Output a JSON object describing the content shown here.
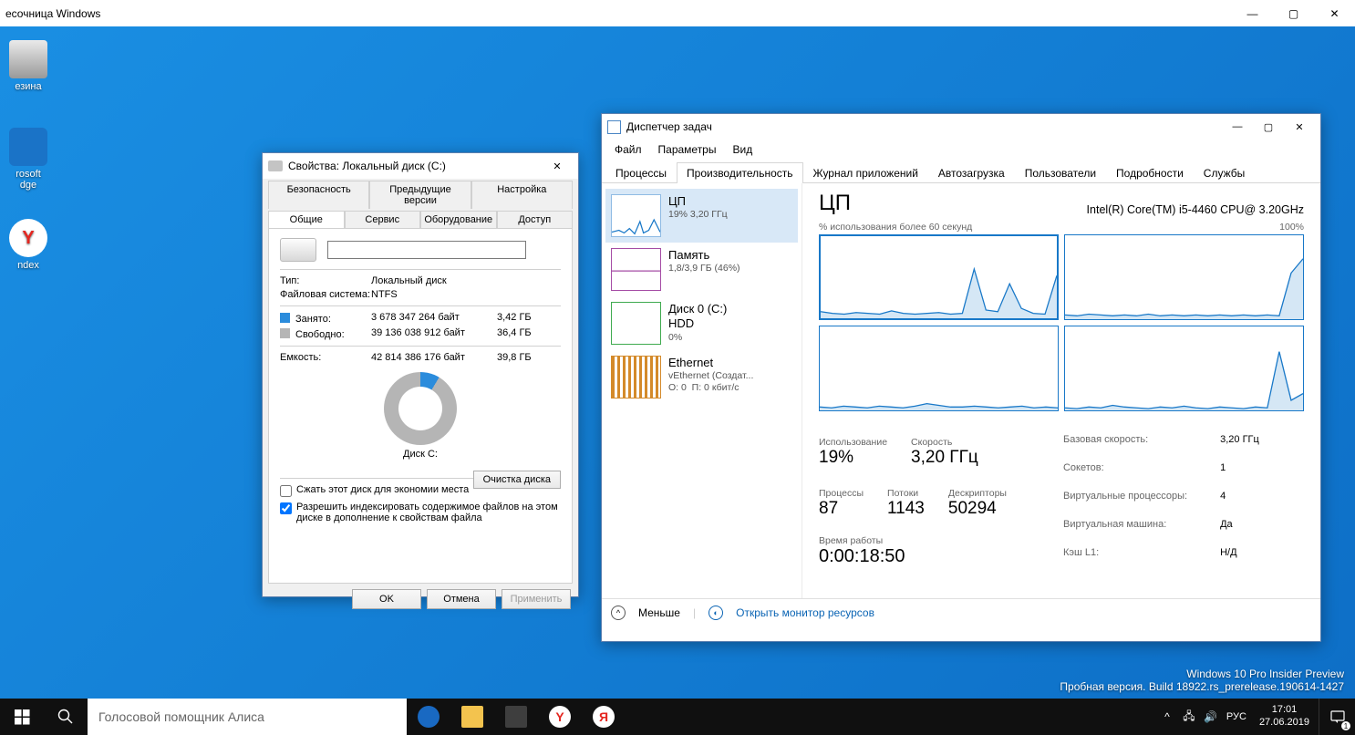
{
  "outer_window": {
    "title": "есочница Windows"
  },
  "desktop_icons": [
    {
      "label": "езина"
    },
    {
      "label": "rosoft\ndge"
    },
    {
      "label": "ndex"
    }
  ],
  "properties": {
    "title": "Свойства: Локальный диск (C:)",
    "tab_row1": [
      "Безопасность",
      "Предыдущие версии",
      "Настройка"
    ],
    "tab_row2": [
      "Общие",
      "Сервис",
      "Оборудование",
      "Доступ"
    ],
    "active_tab": "Общие",
    "name_value": "",
    "type_label": "Тип:",
    "type_value": "Локальный диск",
    "fs_label": "Файловая система:",
    "fs_value": "NTFS",
    "used_label": "Занято:",
    "used_bytes": "3 678 347 264 байт",
    "used_gb": "3,42 ГБ",
    "free_label": "Свободно:",
    "free_bytes": "39 136 038 912 байт",
    "free_gb": "36,4 ГБ",
    "cap_label": "Емкость:",
    "cap_bytes": "42 814 386 176 байт",
    "cap_gb": "39,8 ГБ",
    "disk_caption": "Диск C:",
    "clean_button": "Очистка диска",
    "compress_label": "Сжать этот диск для экономии места",
    "index_label": "Разрешить индексировать содержимое файлов на этом диске в дополнение к свойствам файла",
    "ok": "OK",
    "cancel": "Отмена",
    "apply": "Применить",
    "colors": {
      "used": "#2b8cdc",
      "free": "#b5b5b5"
    }
  },
  "task_manager": {
    "title": "Диспетчер задач",
    "menu": [
      "Файл",
      "Параметры",
      "Вид"
    ],
    "tabs": [
      "Процессы",
      "Производительность",
      "Журнал приложений",
      "Автозагрузка",
      "Пользователи",
      "Подробности",
      "Службы"
    ],
    "active_tab": "Производительность",
    "side": [
      {
        "title": "ЦП",
        "sub": "19%  3,20 ГГц",
        "selected": true
      },
      {
        "title": "Память",
        "sub": "1,8/3,9 ГБ (46%)",
        "selected": false
      },
      {
        "title": "Диск 0 (C:)\nHDD",
        "sub": "0%",
        "selected": false
      },
      {
        "title": "Ethernet",
        "sub": "vEthernet (Создат...\nО: 0  П: 0 кбит/с",
        "selected": false
      }
    ],
    "main": {
      "heading": "ЦП",
      "cpu_name": "Intel(R) Core(TM) i5-4460 CPU@ 3.20GHz",
      "caption_left": "% использования более 60 секунд",
      "caption_right": "100%",
      "stats1": [
        {
          "label": "Использование",
          "value": "19%"
        },
        {
          "label": "Скорость",
          "value": "3,20 ГГц"
        }
      ],
      "stats2": [
        {
          "label": "Процессы",
          "value": "87"
        },
        {
          "label": "Потоки",
          "value": "1143"
        },
        {
          "label": "Дескрипторы",
          "value": "50294"
        }
      ],
      "kv": [
        [
          "Базовая скорость:",
          "3,20 ГГц"
        ],
        [
          "Сокетов:",
          "1"
        ],
        [
          "Виртуальные процессоры:",
          "4"
        ],
        [
          "Виртуальная машина:",
          "Да"
        ],
        [
          "Кэш L1:",
          "Н/Д"
        ]
      ],
      "uptime_label": "Время работы",
      "uptime_value": "0:00:18:50"
    },
    "footer": {
      "fewer": "Меньше",
      "monitor": "Открыть монитор ресурсов"
    }
  },
  "chart_data": [
    {
      "type": "line",
      "title": "core0",
      "xlabel": "",
      "ylabel": "",
      "ylim": [
        0,
        100
      ],
      "x": [
        0,
        5,
        10,
        15,
        20,
        25,
        30,
        35,
        40,
        45,
        50,
        55,
        60,
        65,
        70,
        75,
        80,
        85,
        90,
        95,
        100
      ],
      "values": [
        8,
        6,
        5,
        7,
        6,
        5,
        9,
        6,
        5,
        6,
        7,
        5,
        6,
        60,
        10,
        8,
        42,
        12,
        6,
        5,
        52
      ]
    },
    {
      "type": "line",
      "title": "core1",
      "xlabel": "",
      "ylabel": "",
      "ylim": [
        0,
        100
      ],
      "x": [
        0,
        5,
        10,
        15,
        20,
        25,
        30,
        35,
        40,
        45,
        50,
        55,
        60,
        65,
        70,
        75,
        80,
        85,
        90,
        95,
        100
      ],
      "values": [
        5,
        4,
        6,
        5,
        4,
        5,
        4,
        6,
        4,
        5,
        4,
        5,
        4,
        5,
        4,
        5,
        4,
        5,
        4,
        55,
        72
      ]
    },
    {
      "type": "line",
      "title": "core2",
      "xlabel": "",
      "ylabel": "",
      "ylim": [
        0,
        100
      ],
      "x": [
        0,
        5,
        10,
        15,
        20,
        25,
        30,
        35,
        40,
        45,
        50,
        55,
        60,
        65,
        70,
        75,
        80,
        85,
        90,
        95,
        100
      ],
      "values": [
        4,
        3,
        5,
        4,
        3,
        5,
        4,
        3,
        5,
        8,
        6,
        4,
        4,
        5,
        4,
        3,
        4,
        5,
        3,
        4,
        3
      ]
    },
    {
      "type": "line",
      "title": "core3",
      "xlabel": "",
      "ylabel": "",
      "ylim": [
        0,
        100
      ],
      "x": [
        0,
        5,
        10,
        15,
        20,
        25,
        30,
        35,
        40,
        45,
        50,
        55,
        60,
        65,
        70,
        75,
        80,
        85,
        90,
        95,
        100
      ],
      "values": [
        3,
        2,
        4,
        3,
        6,
        4,
        3,
        2,
        4,
        3,
        5,
        3,
        2,
        4,
        3,
        2,
        4,
        3,
        70,
        12,
        20
      ]
    }
  ],
  "watermark": {
    "line1": "Windows 10 Pro Insider Preview",
    "line2": "Пробная версия. Build 18922.rs_prerelease.190614-1427"
  },
  "taskbar": {
    "search_placeholder": "Голосовой помощник Алиса",
    "lang": "РУС",
    "time": "17:01",
    "date": "27.06.2019",
    "notif_count": "1"
  }
}
